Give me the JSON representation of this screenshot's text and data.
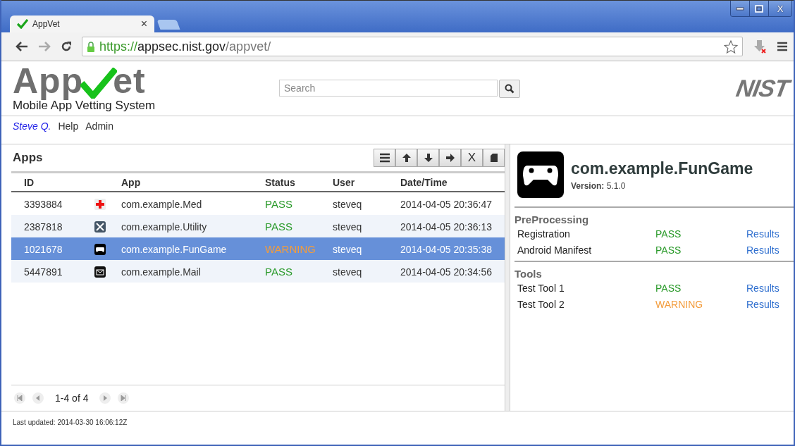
{
  "browser": {
    "tab": {
      "title": "AppVet",
      "close": "×"
    },
    "url": {
      "scheme": "https://",
      "host": "appsec.nist.gov",
      "path": "/appvet/"
    },
    "window_close": "X"
  },
  "header": {
    "logo": {
      "left": "App",
      "right": "et"
    },
    "subtitle": "Mobile App Vetting System",
    "search": {
      "placeholder": "Search"
    },
    "org_logo": "NIST"
  },
  "nav": [
    {
      "label": "Steve Q.",
      "kind": "user"
    },
    {
      "label": "Help",
      "kind": "link"
    },
    {
      "label": "Admin",
      "kind": "link"
    }
  ],
  "apps": {
    "title": "Apps",
    "toolbar": [
      {
        "kind": "menu"
      },
      {
        "kind": "up"
      },
      {
        "kind": "down"
      },
      {
        "kind": "right"
      },
      {
        "kind": "text",
        "label": "X"
      },
      {
        "kind": "doc"
      }
    ],
    "columns": [
      "ID",
      "App",
      "Status",
      "User",
      "Date/Time"
    ],
    "rows": [
      {
        "id": "3393884",
        "kind": "med",
        "app": "com.example.Med",
        "status": "PASS",
        "color": "#2a9a2a",
        "user": "steveq",
        "time": "2014-04-05 20:36:47",
        "selected": false
      },
      {
        "id": "2387818",
        "kind": "utility",
        "app": "com.example.Utility",
        "status": "PASS",
        "color": "#2a9a2a",
        "user": "steveq",
        "time": "2014-04-05 20:36:13",
        "selected": false
      },
      {
        "id": "1021678",
        "kind": "game",
        "app": "com.example.FunGame",
        "status": "WARNING",
        "color": "#f39c3c",
        "user": "steveq",
        "time": "2014-04-05 20:35:38",
        "selected": true
      },
      {
        "id": "5447891",
        "kind": "mail",
        "app": "com.example.Mail",
        "status": "PASS",
        "color": "#2a9a2a",
        "user": "steveq",
        "time": "2014-04-05 20:34:56",
        "selected": false
      }
    ],
    "pager": "1-4 of 4"
  },
  "detail": {
    "kind": "game",
    "name": "com.example.FunGame",
    "version_label": "Version:",
    "version": "5.1.0",
    "sections": [
      {
        "title": "PreProcessing",
        "items": [
          {
            "name": "Registration",
            "status": "PASS",
            "color": "#2a9a2a",
            "link": "Results"
          },
          {
            "name": "Android Manifest",
            "status": "PASS",
            "color": "#2a9a2a",
            "link": "Results"
          }
        ]
      },
      {
        "title": "Tools",
        "items": [
          {
            "name": "Test Tool 1",
            "status": "PASS",
            "color": "#2a9a2a",
            "link": "Results"
          },
          {
            "name": "Test Tool 2",
            "status": "WARNING",
            "color": "#f39c3c",
            "link": "Results"
          }
        ]
      }
    ]
  },
  "footer": "Last updated: 2014-03-30 16:06:12Z"
}
